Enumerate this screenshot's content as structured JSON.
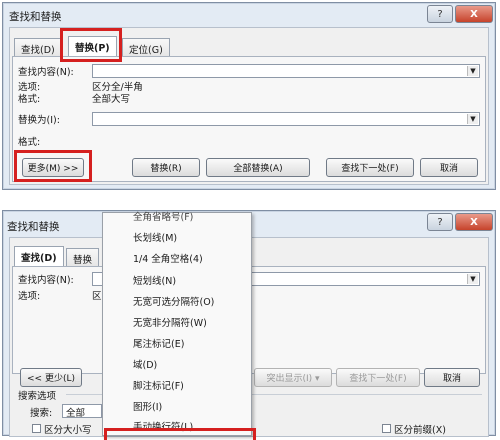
{
  "dialog_top": {
    "title": "查找和替换",
    "window_buttons": {
      "help": "?",
      "close": "X"
    },
    "tabs": [
      "查找(D)",
      "替换(P)",
      "定位(G)"
    ],
    "find_label": "查找内容(N):",
    "options_label": "选项:",
    "options_value": "区分全/半角",
    "format_label": "格式:",
    "format_value": "全部大写",
    "replace_label": "替换为(I):",
    "replace_format_label": "格式:",
    "buttons": {
      "more": "更多(M) >>",
      "replace": "替换(R)",
      "replace_all": "全部替换(A)",
      "find_next": "查找下一处(F)",
      "cancel": "取消"
    }
  },
  "dialog_bottom": {
    "title": "查找和替换",
    "window_buttons": {
      "help": "?",
      "close": "X"
    },
    "tabs": [
      "查找(D)",
      "替换"
    ],
    "find_label": "查找内容(N):",
    "options_label": "选项:",
    "options_value_partial": "区",
    "buttons": {
      "less": "<< 更少(L)",
      "highlight_partial": "突出显示(I) ▾",
      "find_next": "查找下一处(F)",
      "cancel": "取消"
    },
    "search_options_heading": "搜索选项",
    "search_label": "搜索:",
    "search_value": "全部",
    "checkboxes": {
      "match_case": "区分大小写",
      "match_prefix": "区分前缀(X)"
    }
  },
  "special_menu": {
    "items": [
      "全角省略号(F)",
      "长划线(M)",
      "1/4 全角空格(4)",
      "短划线(N)",
      "无宽可选分隔符(O)",
      "无宽非分隔符(W)",
      "尾注标记(E)",
      "域(D)",
      "脚注标记(F)",
      "图形(I)",
      "手动换行符(L)"
    ]
  },
  "colors": {
    "highlight": "#d5201f",
    "dialog_bg": "#e3ebf4",
    "menu_bg": "#f9f9f9"
  }
}
